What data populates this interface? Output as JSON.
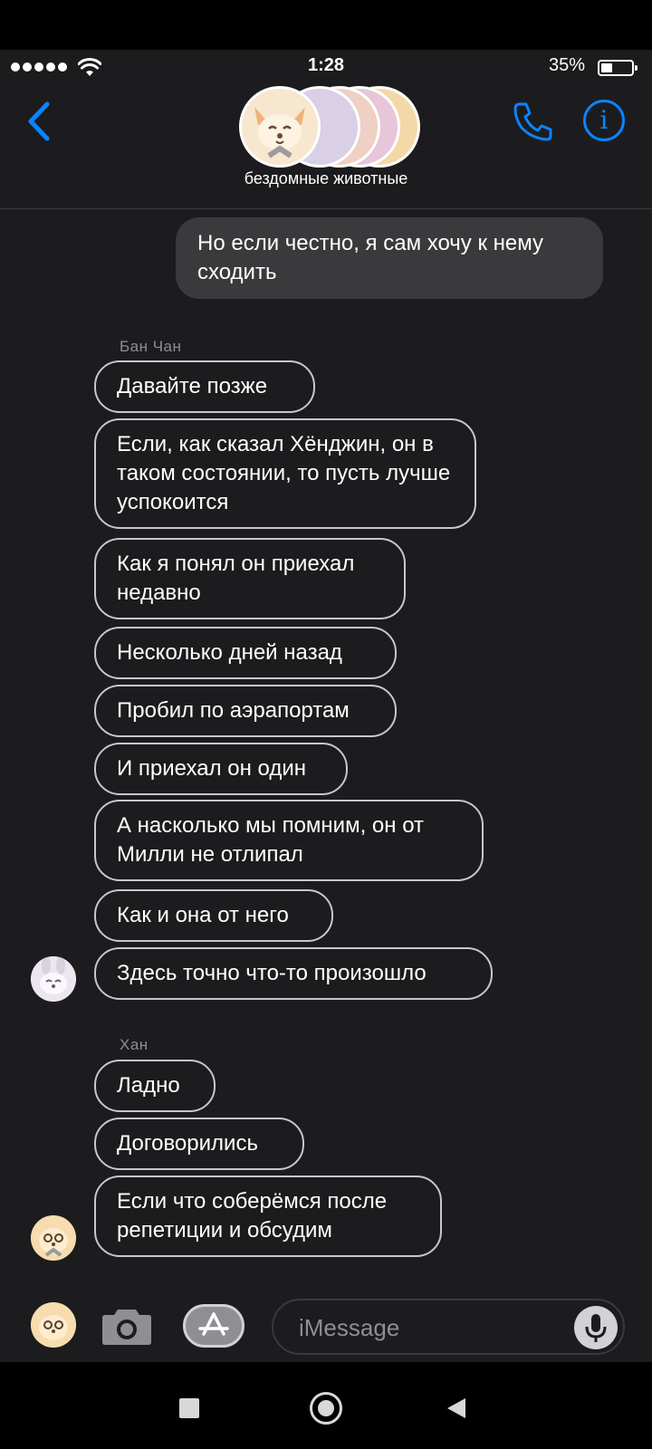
{
  "status_bar": {
    "time": "1:28",
    "battery": "35%"
  },
  "header": {
    "group_name": "бездомные животные"
  },
  "outgoing": [
    "Но если честно, я сам хочу к нему сходить"
  ],
  "threads": [
    {
      "sender": "Бан Чан",
      "messages": [
        "Давайте позже",
        "Если, как сказал Хёнджин, он в таком состоянии, то пусть лучше успокоится",
        "Как я понял он приехал недавно",
        "Несколько дней назад",
        "Пробил по аэрапортам",
        "И приехал он один",
        "А насколько мы помним, он от Милли не отлипал",
        "Как и она от него",
        "Здесь точно что-то произошло"
      ]
    },
    {
      "sender": "Хан",
      "messages": [
        "Ладно",
        "Договорились",
        "Если что соберёмся после репетиции и обсудим"
      ]
    }
  ],
  "composer": {
    "placeholder": "iMessage"
  },
  "icons": {
    "back": "chevron-left-icon",
    "call": "phone-icon",
    "info": "info-icon",
    "camera": "camera-icon",
    "apps": "app-store-icon",
    "mic": "microphone-icon"
  },
  "colors": {
    "accent": "#0a84ff",
    "background": "#1c1c1e",
    "outgoing_bubble": "#3a3a3c"
  }
}
